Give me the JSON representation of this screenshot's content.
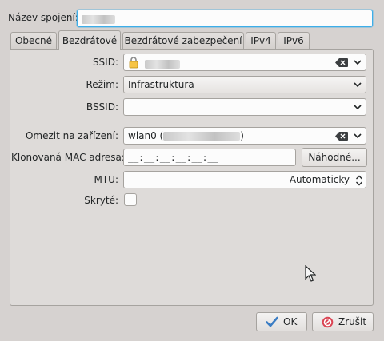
{
  "connection_name": {
    "label": "Název spojení:",
    "value_redacted": true
  },
  "tabs": [
    {
      "label": "Obecné"
    },
    {
      "label": "Bezdrátové"
    },
    {
      "label": "Bezdrátové zabezpečení"
    },
    {
      "label": "IPv4"
    },
    {
      "label": "IPv6"
    }
  ],
  "active_tab_index": 1,
  "form": {
    "ssid": {
      "label": "SSID:"
    },
    "mode": {
      "label": "Režim:",
      "value": "Infrastruktura"
    },
    "bssid": {
      "label": "BSSID:",
      "value": ""
    },
    "restrict_device": {
      "label": "Omezit na zařízení:",
      "value_prefix": "wlan0 (",
      "value_suffix": ")"
    },
    "cloned_mac": {
      "label": "Klonovaná MAC adresa:",
      "value": "__:__:__:__:__:__",
      "random_button": "Náhodné..."
    },
    "mtu": {
      "label": "MTU:",
      "value": "Automaticky"
    },
    "hidden": {
      "label": "Skryté:",
      "checked": false
    }
  },
  "buttons": {
    "ok": "OK",
    "cancel": "Zrušit"
  },
  "icons": {
    "lock": "lock-icon",
    "clear": "clear-text-icon",
    "ok": "checkmark-icon",
    "cancel": "cancel-icon"
  },
  "colors": {
    "window_bg": "#d6d2d0",
    "focus": "#3daee9",
    "cancel_red": "#da4453",
    "ok_blue": "#3b7dc4"
  }
}
